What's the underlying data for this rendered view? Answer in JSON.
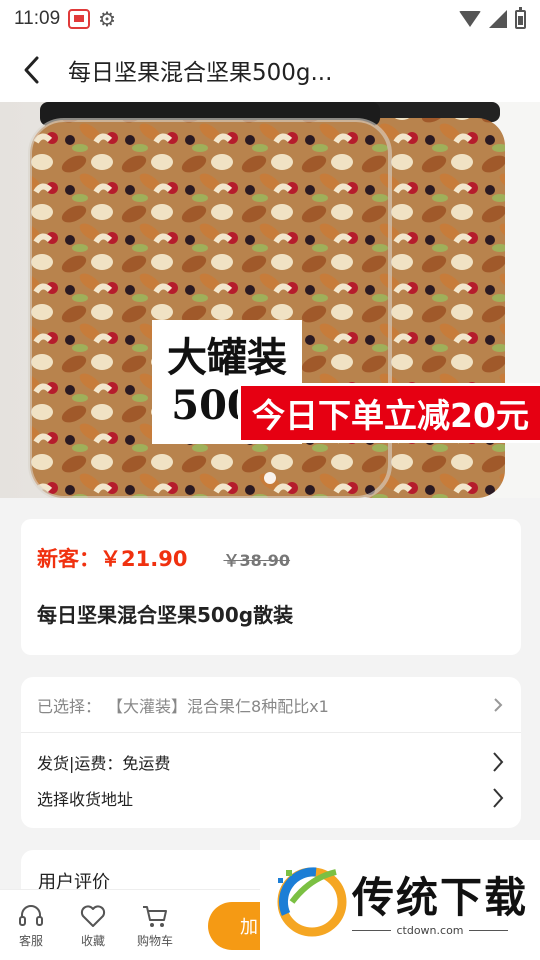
{
  "status_bar": {
    "time": "11:09"
  },
  "nav": {
    "title": "每日坚果混合坚果500g..."
  },
  "hero": {
    "label_line1": "大罐装",
    "label_line2": "500g",
    "promo": "今日下单立减20元",
    "carousel_total": 1,
    "carousel_index": 1
  },
  "price": {
    "new_label": "新客：￥21.90",
    "old_label": "￥38.90",
    "accent_color": "#f0310f"
  },
  "product": {
    "name": "每日坚果混合坚果500g散装"
  },
  "options": {
    "selected_label": "已选择：",
    "selected_value": "【大灌装】混合果仁8种配比x1",
    "shipping": "发货|运费：免运费",
    "address": "选择收货地址"
  },
  "reviews": {
    "title": "用户评价"
  },
  "bottom_bar": {
    "tabs": [
      {
        "label": "客服",
        "icon": "headset-icon"
      },
      {
        "label": "收藏",
        "icon": "heart-icon"
      },
      {
        "label": "购物车",
        "icon": "cart-icon"
      }
    ],
    "cart_button": "加",
    "button_color": "#f59a14"
  },
  "watermark": {
    "name": "传统下载",
    "url": "ctdown.com"
  }
}
